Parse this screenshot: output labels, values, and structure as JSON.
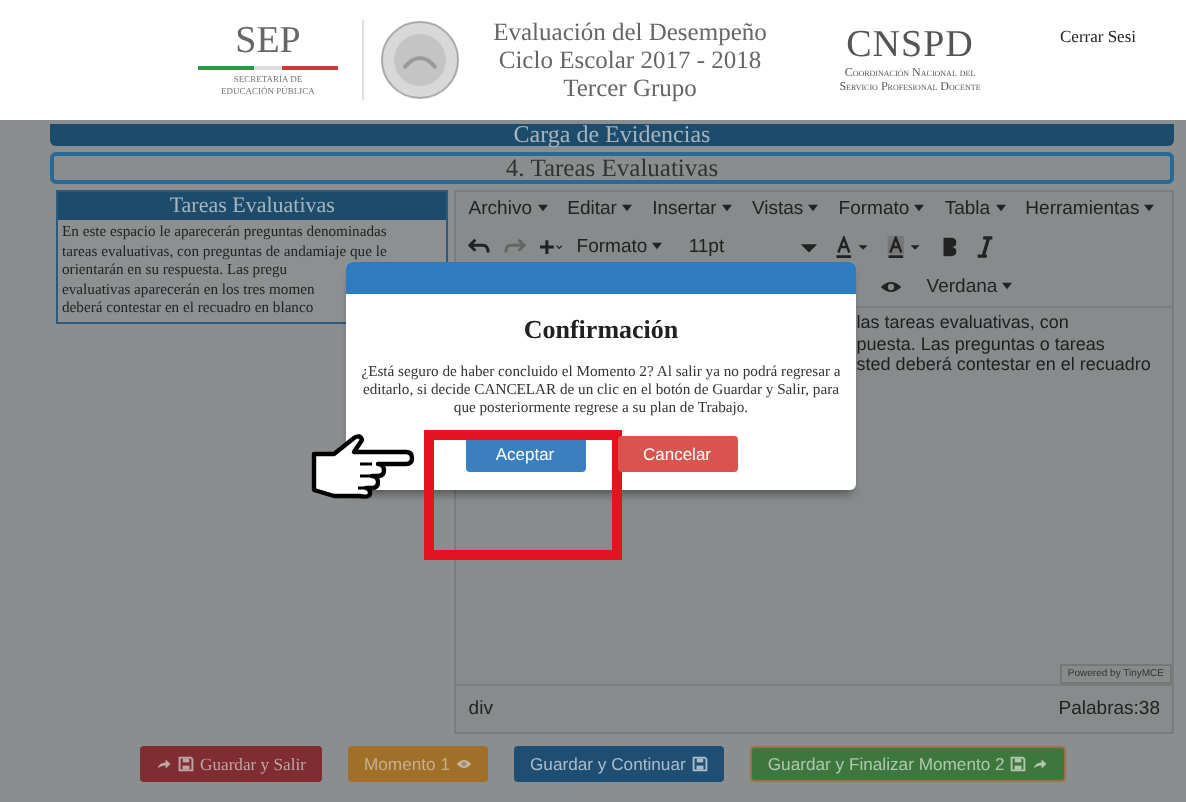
{
  "header": {
    "sep": {
      "name": "SEP",
      "subtitle_lines": [
        "SECRETARÍA DE",
        "EDUCACIÓN PÚBLICA"
      ]
    },
    "title_lines": [
      "Evaluación del Desempeño",
      "Ciclo Escolar 2017 - 2018",
      "Tercer Grupo"
    ],
    "cnspd": {
      "name": "CNSPD",
      "subtitle_lines": [
        "Coordinación Nacional del",
        "Servicio Profesional Docente"
      ]
    },
    "logout": "Cerrar Sesi"
  },
  "section_bar": "Carga de Evidencias",
  "step_bar": "4. Tareas Evaluativas",
  "instructions": {
    "title": "Tareas Evaluativas",
    "lines": [
      "En este espacio le aparecerán preguntas denominadas",
      "tareas evaluativas, con preguntas de andamiaje que le",
      "orientarán en su respuesta. Las pregu",
      "evaluativas aparecerán en los tres momen",
      "deberá contestar en el recuadro en blanco"
    ]
  },
  "editor": {
    "menus": [
      "Archivo",
      "Editar",
      "Insertar",
      "Vistas",
      "Formato",
      "Tabla",
      "Herramientas"
    ],
    "format": "Formato",
    "size": "11pt",
    "font": "Verdana",
    "body_lines": [
      "las tareas evaluativas, con",
      "puesta. Las preguntas o tareas",
      "sted deberá contestar en el recuadro"
    ],
    "branding": "Powered by TinyMCE",
    "path": "div",
    "word_count": "Palabras:38"
  },
  "actions": [
    {
      "label": "Guardar  y  Salir",
      "kind": "danger"
    },
    {
      "label": "Momento 1",
      "kind": "warning"
    },
    {
      "label": "Guardar y Continuar",
      "kind": "primary"
    },
    {
      "label": "Guardar y Finalizar Momento 2",
      "kind": "success"
    }
  ],
  "modal": {
    "title": "Confirmación",
    "message": "¿Está seguro de haber concluido el Momento 2? Al salir ya no podrá regresar a editarlo, si decide CANCELAR de un clic en el botón de Guardar y Salir, para que posteriormente regrese a su plan de Trabajo.",
    "buttons": [
      {
        "label": "Aceptar",
        "kind": "primary",
        "highlighted": true
      },
      {
        "label": "Cancelar",
        "kind": "danger",
        "highlighted": false
      }
    ]
  }
}
